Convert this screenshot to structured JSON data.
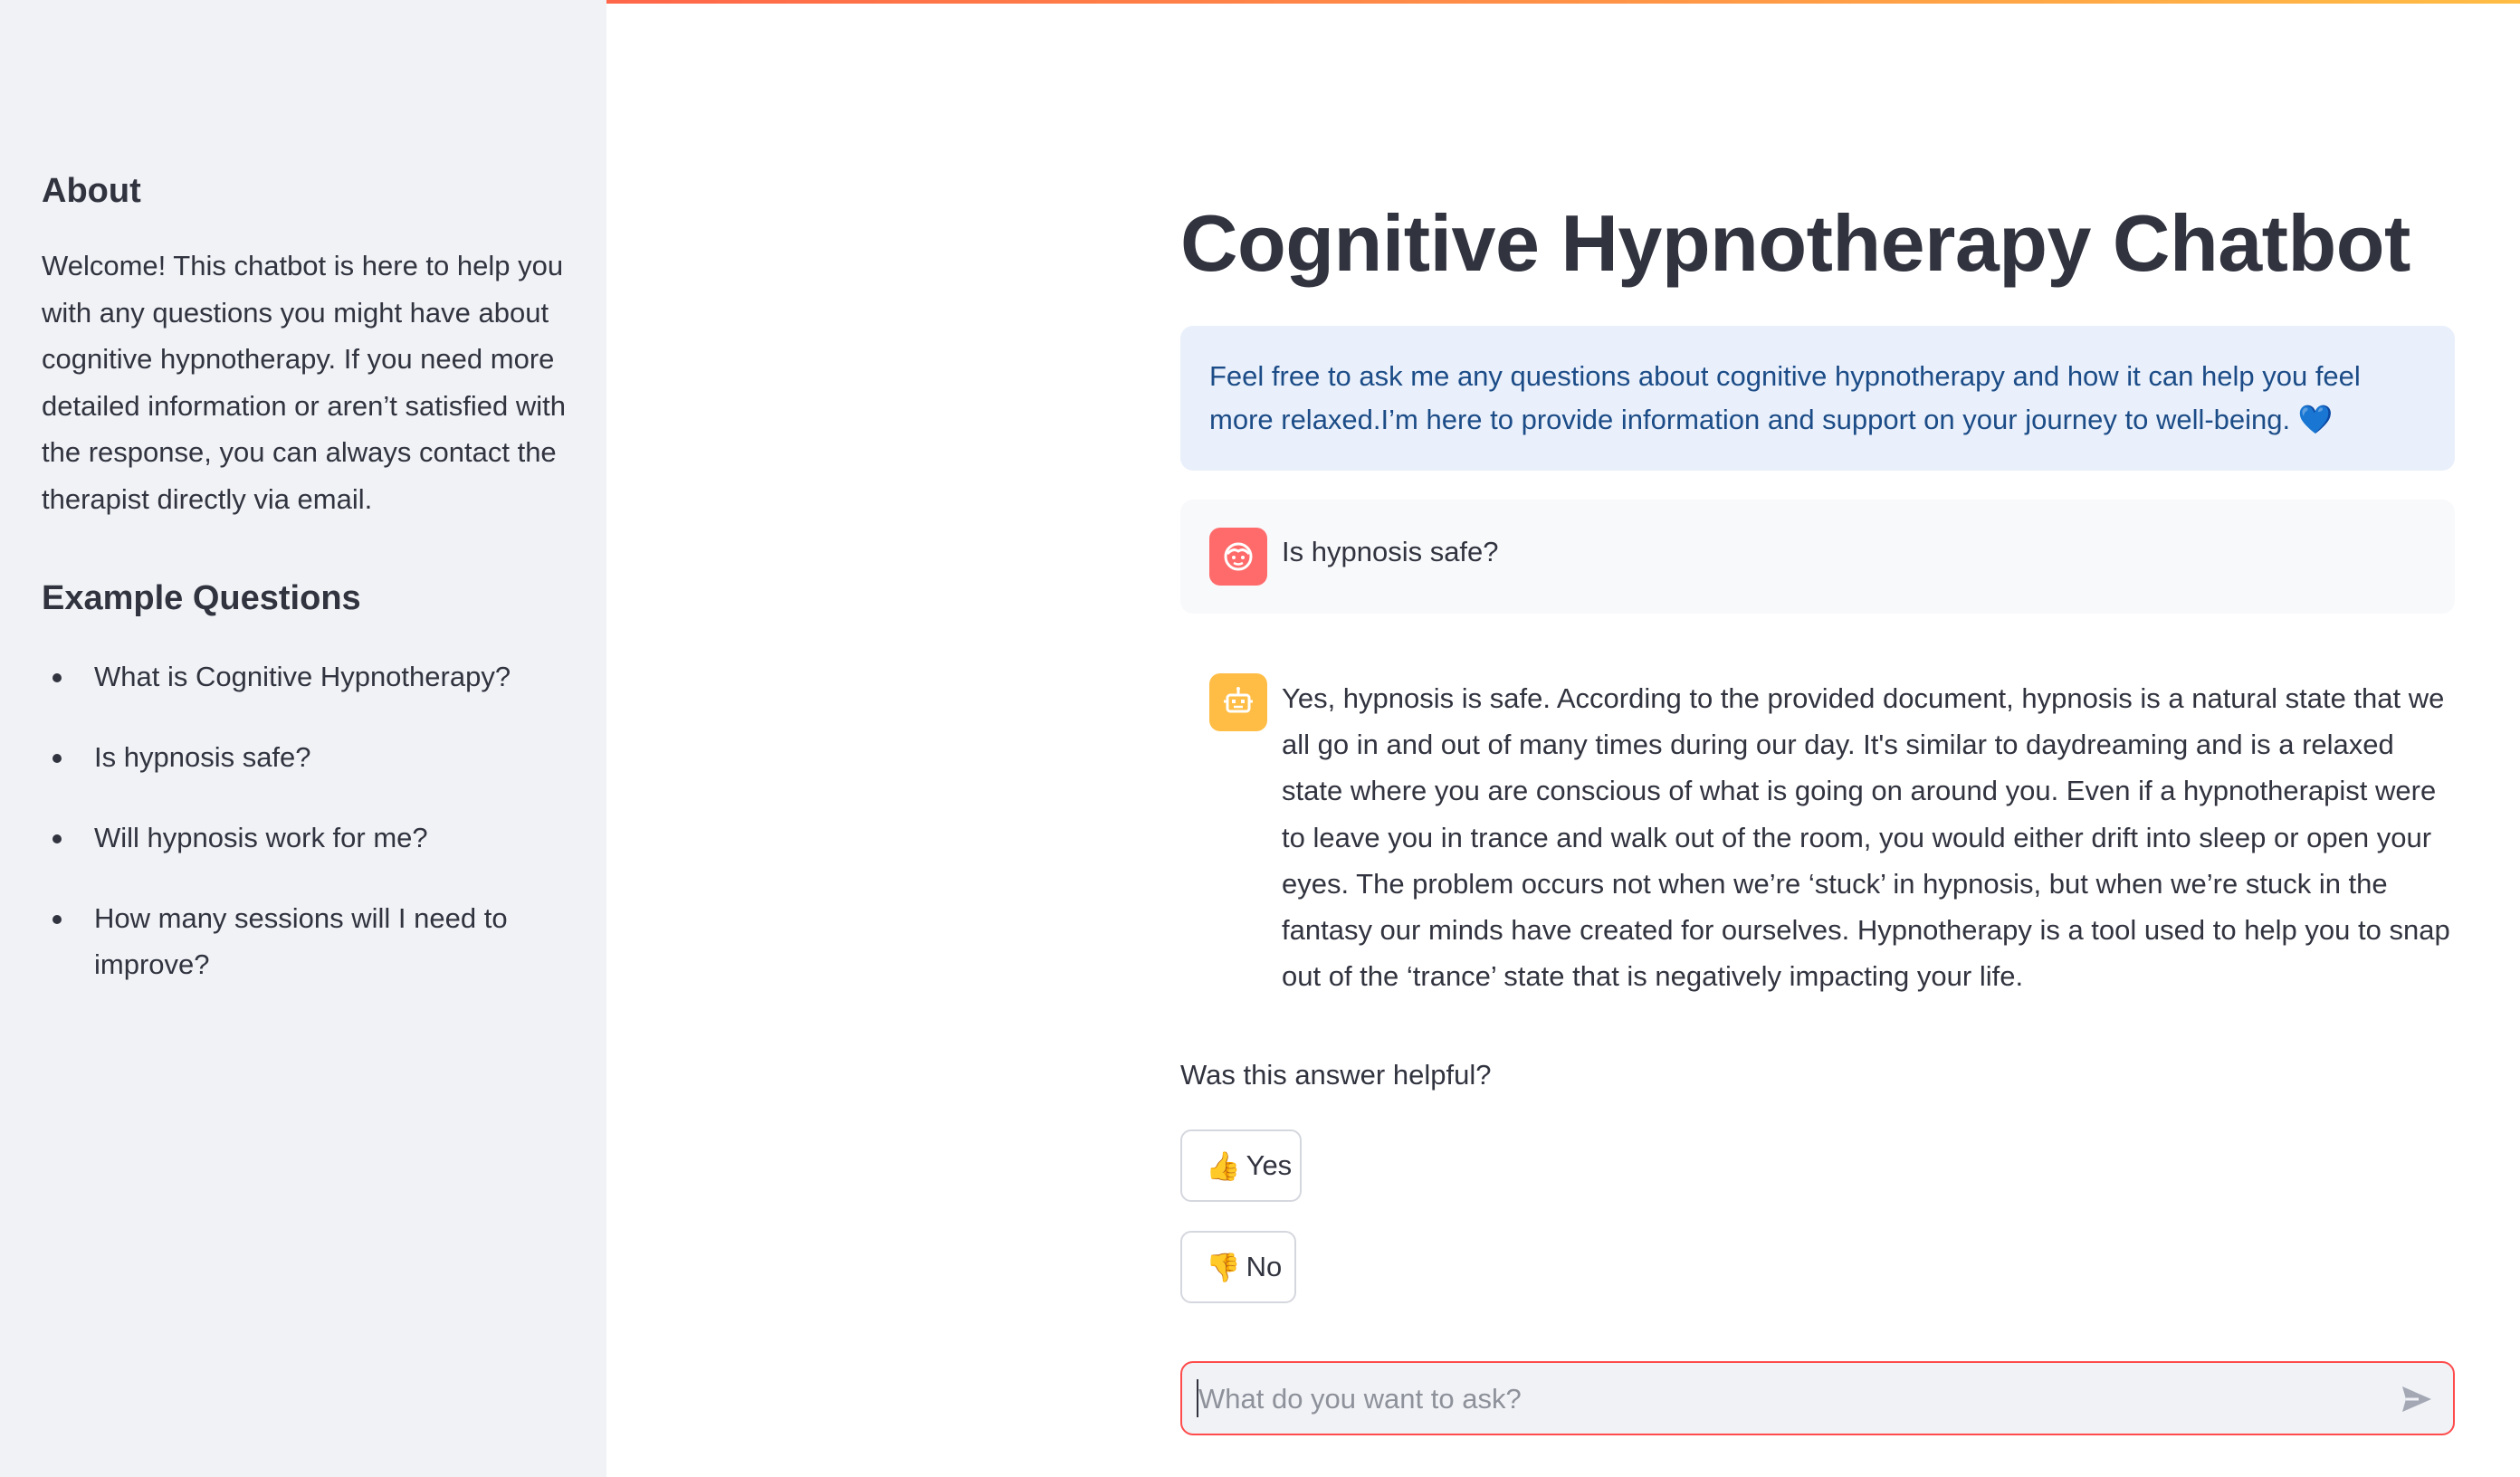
{
  "sidebar": {
    "about_heading": "About",
    "about_text": "Welcome! This chatbot is here to help you with any questions you might have about cognitive hypnotherapy. If you need more detailed information or aren’t satisfied with the response, you can always contact the therapist directly via email.",
    "examples_heading": "Example Questions",
    "examples": [
      "What is Cognitive Hypnotherapy?",
      "Is hypnosis safe?",
      "Will hypnosis work for me?",
      "How many sessions will I need to improve?"
    ]
  },
  "main": {
    "title": "Cognitive Hypnotherapy Chatbot",
    "info": "Feel free to ask me any questions about cognitive hypnotherapy and how it can help you feel more relaxed.I’m here to provide information and support on your journey to well-being. 💙",
    "messages": [
      {
        "role": "user",
        "avatar_icon": "face-icon",
        "text": "Is hypnosis safe?"
      },
      {
        "role": "assistant",
        "avatar_icon": "robot-icon",
        "text": "Yes, hypnosis is safe. According to the provided document, hypnosis is a natural state that we all go in and out of many times during our day. It's similar to daydreaming and is a relaxed state where you are conscious of what is going on around you. Even if a hypnotherapist were to leave you in trance and walk out of the room, you would either drift into sleep or open your eyes. The problem occurs not when we’re ‘stuck’ in hypnosis, but when we’re stuck in the fantasy our minds have created for ourselves. Hypnotherapy is a tool used to help you to snap out of the ‘trance’ state that is negatively impacting your life."
      }
    ],
    "feedback": {
      "question": "Was this answer helpful?",
      "yes_emoji": "👍",
      "yes_label": "Yes",
      "no_emoji": "👎",
      "no_label": "No"
    },
    "chat_input": {
      "placeholder": "What do you want to ask?",
      "value": "",
      "send_icon": "send-icon"
    }
  },
  "colors": {
    "accent": "#ff4b4b",
    "sidebar_bg": "#f0f2f6",
    "info_bg": "#e9f0fb",
    "info_text": "#1c4c87",
    "user_avatar": "#ff6b6b",
    "bot_avatar": "#ffbd45"
  }
}
